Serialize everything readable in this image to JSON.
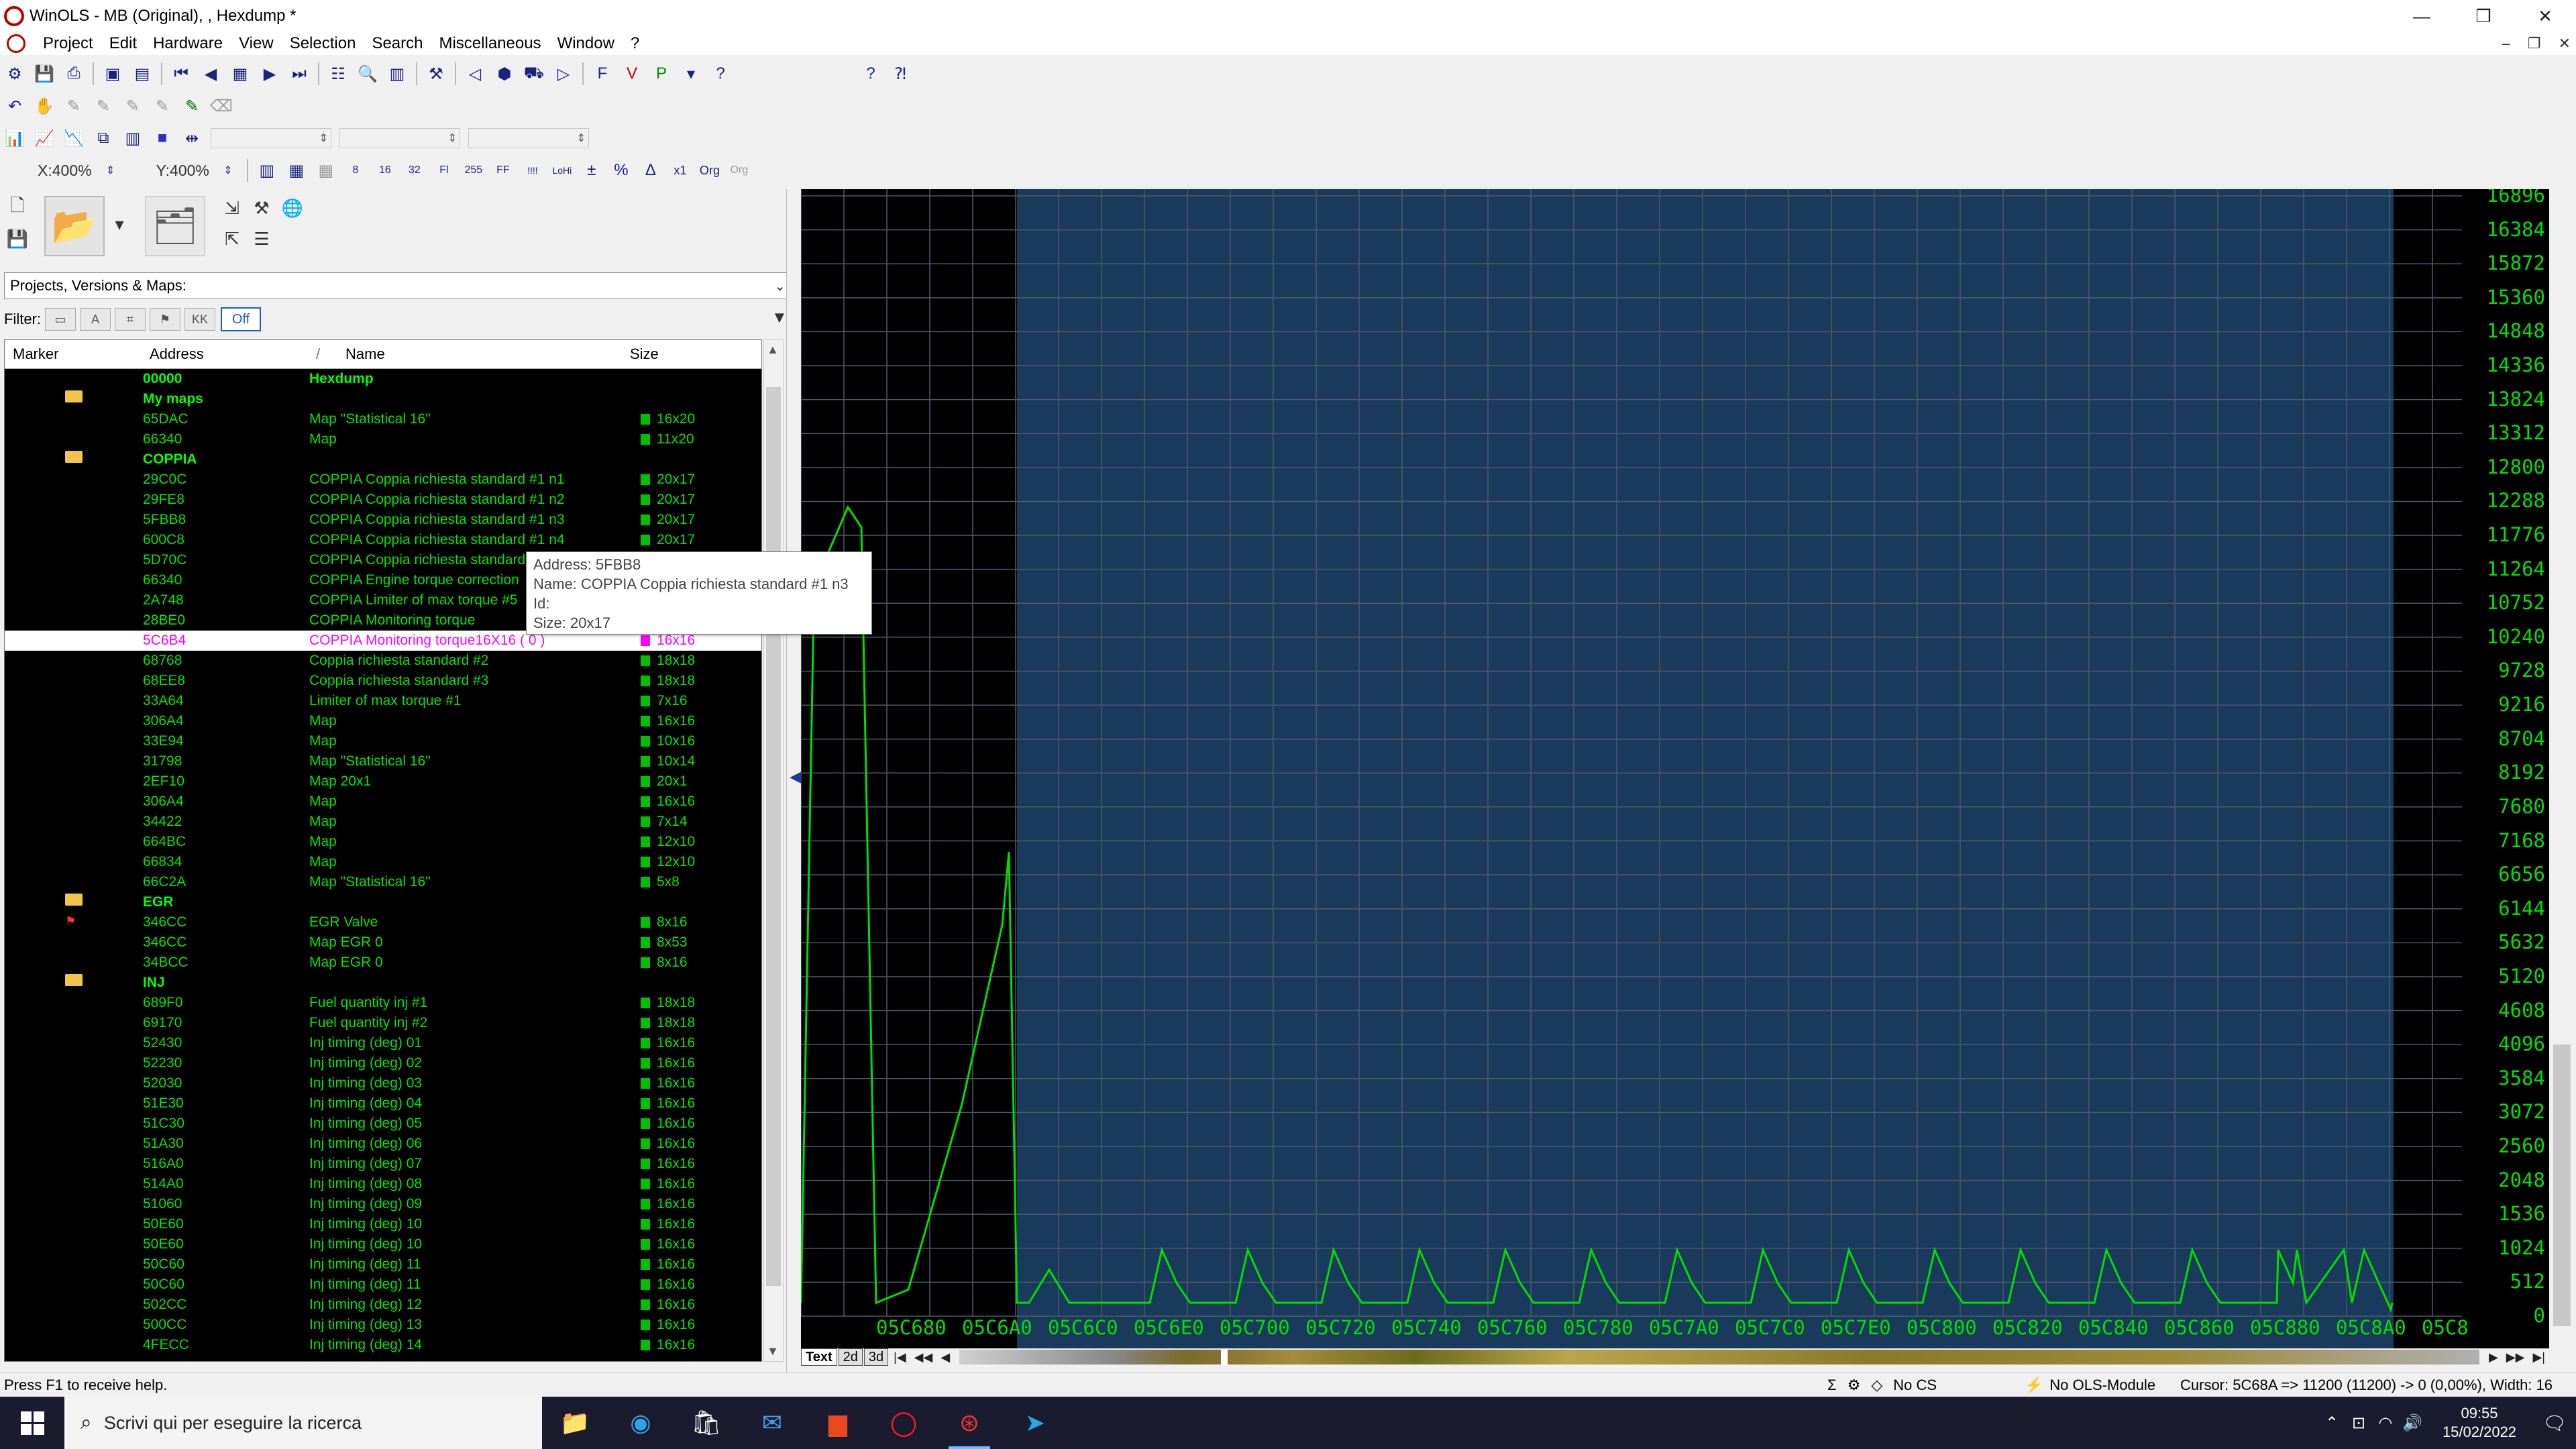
{
  "window": {
    "title": "WinOLS - MB (Original), , Hexdump *",
    "app_logo_text": "OLS"
  },
  "menu": [
    "Project",
    "Edit",
    "Hardware",
    "View",
    "Selection",
    "Search",
    "Miscellaneous",
    "Window",
    "?"
  ],
  "zoom": {
    "x": "X:400%",
    "y": "Y:400%"
  },
  "left_panel": {
    "combo": "Projects, Versions & Maps:",
    "filter_label": "Filter:",
    "filter_off": "Off",
    "columns": [
      "Marker",
      "Address",
      "/",
      "Name",
      "Size"
    ]
  },
  "rows": [
    {
      "marker": "",
      "addr": "00000",
      "name": "Hexdump",
      "size": "",
      "group": true
    },
    {
      "marker": "folder",
      "addr": "My maps",
      "name": "",
      "size": "",
      "group": true
    },
    {
      "marker": "",
      "addr": "65DAC",
      "name": "Map \"Statistical 16\"",
      "size": "16x20"
    },
    {
      "marker": "",
      "addr": "66340",
      "name": "Map",
      "size": "11x20"
    },
    {
      "marker": "folder",
      "addr": "COPPIA",
      "name": "",
      "size": "",
      "group": true
    },
    {
      "marker": "",
      "addr": "29C0C",
      "name": "COPPIA Coppia richiesta standard #1 n1",
      "size": "20x17"
    },
    {
      "marker": "",
      "addr": "29FE8",
      "name": "COPPIA Coppia richiesta standard #1 n2",
      "size": "20x17"
    },
    {
      "marker": "",
      "addr": "5FBB8",
      "name": "COPPIA Coppia richiesta standard #1 n3",
      "size": "20x17"
    },
    {
      "marker": "",
      "addr": "600C8",
      "name": "COPPIA Coppia richiesta standard #1 n4",
      "size": "20x17"
    },
    {
      "marker": "",
      "addr": "5D70C",
      "name": "COPPIA Coppia richiesta standard",
      "size": ""
    },
    {
      "marker": "",
      "addr": "66340",
      "name": "COPPIA Engine torque correction",
      "size": ""
    },
    {
      "marker": "",
      "addr": "2A748",
      "name": "COPPIA Limiter of max torque #5",
      "size": ""
    },
    {
      "marker": "",
      "addr": "28BE0",
      "name": "COPPIA Monitoring torque",
      "size": ""
    },
    {
      "marker": "",
      "addr": "5C6B4",
      "name": "COPPIA Monitoring torque16X16 ( 0 )",
      "size": "16x16",
      "selected": true
    },
    {
      "marker": "",
      "addr": "68768",
      "name": "Coppia richiesta standard #2",
      "size": "18x18"
    },
    {
      "marker": "",
      "addr": "68EE8",
      "name": "Coppia richiesta standard #3",
      "size": "18x18"
    },
    {
      "marker": "",
      "addr": "33A64",
      "name": "Limiter of max torque #1",
      "size": "7x16"
    },
    {
      "marker": "",
      "addr": "306A4",
      "name": "Map",
      "size": "16x16"
    },
    {
      "marker": "",
      "addr": "33E94",
      "name": "Map",
      "size": "10x16"
    },
    {
      "marker": "",
      "addr": "31798",
      "name": "Map \"Statistical 16\"",
      "size": "10x14"
    },
    {
      "marker": "",
      "addr": "2EF10",
      "name": "Map 20x1",
      "size": "20x1"
    },
    {
      "marker": "",
      "addr": "306A4",
      "name": "Map",
      "size": "16x16"
    },
    {
      "marker": "",
      "addr": "34422",
      "name": "Map",
      "size": "7x14"
    },
    {
      "marker": "",
      "addr": "664BC",
      "name": "Map",
      "size": "12x10"
    },
    {
      "marker": "",
      "addr": "66834",
      "name": "Map",
      "size": "12x10"
    },
    {
      "marker": "",
      "addr": "66C2A",
      "name": "Map \"Statistical 16\"",
      "size": "5x8"
    },
    {
      "marker": "folder",
      "addr": "EGR",
      "name": "",
      "size": "",
      "group": true
    },
    {
      "marker": "flag",
      "addr": "346CC",
      "name": "EGR Valve",
      "size": "8x16"
    },
    {
      "marker": "",
      "addr": "346CC",
      "name": "Map EGR 0",
      "size": "8x53"
    },
    {
      "marker": "",
      "addr": "34BCC",
      "name": "Map EGR 0",
      "size": "8x16"
    },
    {
      "marker": "folder",
      "addr": "INJ",
      "name": "",
      "size": "",
      "group": true
    },
    {
      "marker": "",
      "addr": "689F0",
      "name": "Fuel quantity inj #1",
      "size": "18x18"
    },
    {
      "marker": "",
      "addr": "69170",
      "name": "Fuel quantity inj #2",
      "size": "18x18"
    },
    {
      "marker": "",
      "addr": "52430",
      "name": "Inj timing (deg) 01",
      "size": "16x16"
    },
    {
      "marker": "",
      "addr": "52230",
      "name": "Inj timing (deg) 02",
      "size": "16x16"
    },
    {
      "marker": "",
      "addr": "52030",
      "name": "Inj timing (deg) 03",
      "size": "16x16"
    },
    {
      "marker": "",
      "addr": "51E30",
      "name": "Inj timing (deg) 04",
      "size": "16x16"
    },
    {
      "marker": "",
      "addr": "51C30",
      "name": "Inj timing (deg) 05",
      "size": "16x16"
    },
    {
      "marker": "",
      "addr": "51A30",
      "name": "Inj timing (deg) 06",
      "size": "16x16"
    },
    {
      "marker": "",
      "addr": "516A0",
      "name": "Inj timing (deg) 07",
      "size": "16x16"
    },
    {
      "marker": "",
      "addr": "514A0",
      "name": "Inj timing (deg) 08",
      "size": "16x16"
    },
    {
      "marker": "",
      "addr": "51060",
      "name": "Inj timing (deg) 09",
      "size": "16x16"
    },
    {
      "marker": "",
      "addr": "50E60",
      "name": "Inj timing (deg) 10",
      "size": "16x16"
    },
    {
      "marker": "",
      "addr": "50E60",
      "name": "Inj timing (deg) 10",
      "size": "16x16"
    },
    {
      "marker": "",
      "addr": "50C60",
      "name": "Inj timing (deg) 11",
      "size": "16x16"
    },
    {
      "marker": "",
      "addr": "50C60",
      "name": "Inj timing (deg) 11",
      "size": "16x16"
    },
    {
      "marker": "",
      "addr": "502CC",
      "name": "Inj timing (deg) 12",
      "size": "16x16"
    },
    {
      "marker": "",
      "addr": "500CC",
      "name": "Inj timing (deg) 13",
      "size": "16x16"
    },
    {
      "marker": "",
      "addr": "4FECC",
      "name": "Inj timing (deg) 14",
      "size": "16x16"
    }
  ],
  "tooltip": {
    "line1": "Address: 5FBB8",
    "line2": "Name: COPPIA Coppia richiesta standard #1 n3",
    "line3": "Id:",
    "line4": "Size: 20x17"
  },
  "graph": {
    "y_ticks": [
      "16896",
      "16384",
      "15872",
      "15360",
      "14848",
      "14336",
      "13824",
      "13312",
      "12800",
      "12288",
      "11776",
      "11264",
      "10752",
      "10240",
      "9728",
      "9216",
      "8704",
      "8192",
      "7680",
      "7168",
      "6656",
      "6144",
      "5632",
      "5120",
      "4608",
      "4096",
      "3584",
      "3072",
      "2560",
      "2048",
      "1536",
      "1024",
      "512",
      "0"
    ],
    "x_ticks": [
      "05C680",
      "05C6A0",
      "05C6C0",
      "05C6E0",
      "05C700",
      "05C720",
      "05C740",
      "05C760",
      "05C780",
      "05C7A0",
      "05C7C0",
      "05C7E0",
      "05C800",
      "05C820",
      "05C840",
      "05C860",
      "05C880",
      "05C8A0",
      "05C8"
    ],
    "colors": {
      "line": "#00dd00",
      "grid": "#3a3a3a",
      "selection": "#1a3a5c",
      "label": "#00e000"
    }
  },
  "tabs": [
    "Text",
    "2d",
    "3d"
  ],
  "status": {
    "help": "Press F1 to receive help.",
    "cs": "No CS",
    "module": "No OLS-Module",
    "cursor": "Cursor: 5C68A => 11200 (11200) -> 0 (0,00%), Width: 16"
  },
  "taskbar": {
    "search_placeholder": "Scrivi qui per eseguire la ricerca",
    "time": "09:55",
    "date": "15/02/2022"
  }
}
